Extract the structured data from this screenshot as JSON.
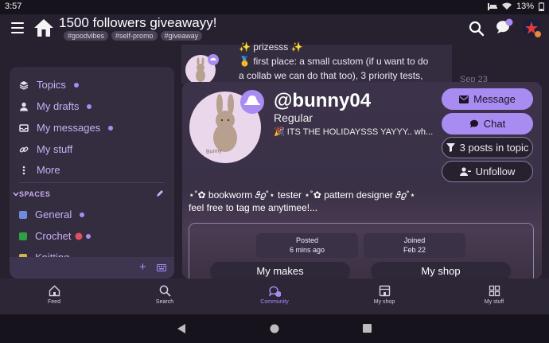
{
  "status_bar": {
    "time": "3:57",
    "battery": "13%"
  },
  "header": {
    "title": "1500 followers giveawayy!",
    "tags": [
      "#goodvibes",
      "#self-promo",
      "#giveaway"
    ]
  },
  "sidebar": {
    "items": [
      {
        "label": "Topics",
        "icon": "layers-icon",
        "dot": true
      },
      {
        "label": "My drafts",
        "icon": "user-icon",
        "dot": true
      },
      {
        "label": "My messages",
        "icon": "inbox-icon",
        "dot": true
      },
      {
        "label": "My stuff",
        "icon": "link-icon",
        "dot": false
      },
      {
        "label": "More",
        "icon": "more-vertical-icon",
        "dot": false
      }
    ],
    "spaces_label": "SPACES",
    "spaces": [
      {
        "label": "General",
        "color": "#6c8ed8"
      },
      {
        "label": "Crochet",
        "color": "#2ea043"
      },
      {
        "label": "Knitting",
        "color": "#d0b54f"
      }
    ]
  },
  "post": {
    "line1": "✨ prizesss ✨",
    "line2": "🥇 first place: a small custom (if u want to do",
    "line3": "a collab we can do that too), 3 priority tests,",
    "date": "Sep 23"
  },
  "user_card": {
    "username": "@bunny04",
    "title": "Regular",
    "status": "🎉 ITS THE HOLIDAYSSS YAYYY.. wh...",
    "bio_line1": "⋆˚✿ bookworm 𝜗𝜚˚⋆ tester ⋆˚✿ pattern designer 𝜗𝜚˚⋆",
    "bio_line2": "feel free to tag me anytimee!...",
    "buttons": {
      "message": "Message",
      "chat": "Chat",
      "posts_in_topic": "3 posts in topic",
      "unfollow": "Unfollow"
    },
    "posted_label": "Posted",
    "posted_value": "6 mins ago",
    "joined_label": "Joined",
    "joined_value": "Feb 22",
    "tabs": [
      "My makes",
      "My shop"
    ],
    "avatar_caption": "Bunny"
  },
  "bottom_nav": [
    {
      "label": "Feed",
      "icon": "home-icon"
    },
    {
      "label": "Search",
      "icon": "search-icon"
    },
    {
      "label": "Community",
      "icon": "community-icon",
      "active": true
    },
    {
      "label": "My shop",
      "icon": "shop-icon"
    },
    {
      "label": "My stuff",
      "icon": "grid-icon"
    }
  ],
  "colors": {
    "accent": "#a98cf2",
    "background": "#26202f",
    "panel": "#342d3f"
  }
}
